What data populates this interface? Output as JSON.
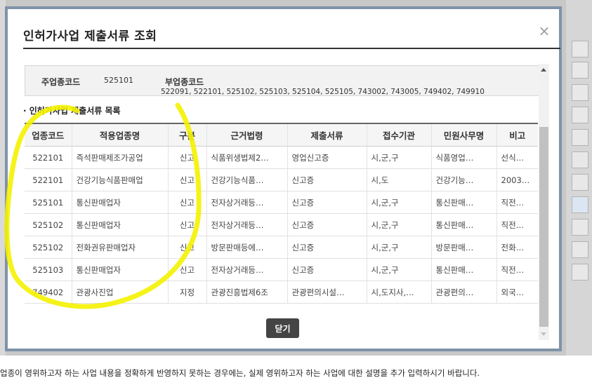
{
  "modal": {
    "title": "인허가사업 제출서류 조회",
    "close_symbol": "×",
    "main_code_label": "주업종코드",
    "main_code_value": "525101",
    "sub_code_label": "부업종코드",
    "sub_code_value": "522091, 522101, 525102, 525103, 525104, 525105, 743002, 743005, 749402, 749910",
    "section_title": "· 인허가사업 제출서류 목록",
    "close_button_label": "닫기"
  },
  "table": {
    "columns": [
      "업종코드",
      "적용업종명",
      "구분",
      "근거법령",
      "제출서류",
      "접수기관",
      "민원사무명",
      "비고"
    ],
    "rows": [
      [
        "522101",
        "즉석판매제조가공업",
        "신고",
        "식품위생법제2…",
        "영업신고증",
        "시,군,구",
        "식품영업…",
        "선식…"
      ],
      [
        "522101",
        "건강기능식품판매업",
        "신고",
        "건강기능식품…",
        "신고증",
        "시,도",
        "건강기능…",
        "2003…"
      ],
      [
        "525101",
        "통신판매업자",
        "신고",
        "전자상거래등…",
        "신고증",
        "시,군,구",
        "통신판매…",
        "직전…"
      ],
      [
        "525102",
        "통신판매업자",
        "신고",
        "전자상거래등…",
        "신고증",
        "시,군,구",
        "통신판매…",
        "직전…"
      ],
      [
        "525102",
        "전화권유판매업자",
        "신고",
        "방문판매등에…",
        "신고증",
        "시,군,구",
        "방문판매…",
        "전화…"
      ],
      [
        "525103",
        "통신판매업자",
        "신고",
        "전자상거래등…",
        "신고증",
        "시,군,구",
        "통신판매…",
        "직전…"
      ],
      [
        "749402",
        "관광사진업",
        "지정",
        "관광진흥법제6조",
        "관광편의시설…",
        "시,도지사,…",
        "관광편의…",
        "외국…"
      ]
    ]
  },
  "background": {
    "footer_text": "업종이 영위하고자 하는 사업 내용을 정확하게 반영하지 못하는 경우에는, 실제 영위하고자 하는 사업에 대한 설명을 추가 입력하시기 바랍니다."
  },
  "colors": {
    "modal_border": "#7f93a8",
    "highlight": "#f4f200",
    "button_bg": "#444444"
  }
}
